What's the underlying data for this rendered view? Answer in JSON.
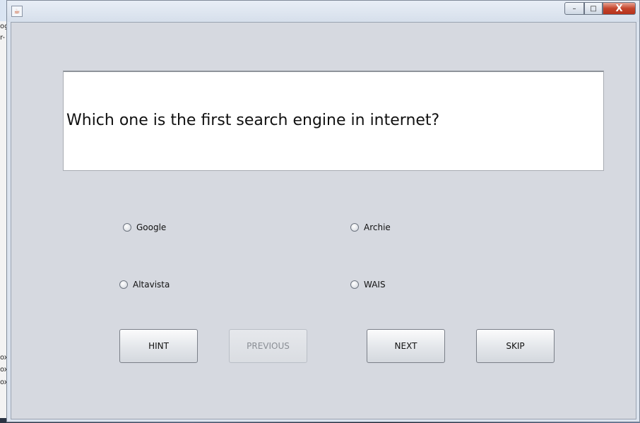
{
  "desktop": {
    "fragments": [
      "og",
      "r-",
      "ox",
      "ox",
      "ox"
    ]
  },
  "window": {
    "title": "",
    "controls": {
      "minimize_icon": "–",
      "maximize_icon": "□",
      "close_icon": "X"
    }
  },
  "quiz": {
    "question": "Which one is the first search engine in internet?",
    "options": [
      {
        "label": "Google",
        "selected": false
      },
      {
        "label": "Archie",
        "selected": false
      },
      {
        "label": "Altavista",
        "selected": false
      },
      {
        "label": "WAIS",
        "selected": false
      }
    ],
    "buttons": {
      "hint": "HINT",
      "previous": "PREVIOUS",
      "next": "NEXT",
      "skip": "SKIP"
    },
    "previous_enabled": false
  }
}
